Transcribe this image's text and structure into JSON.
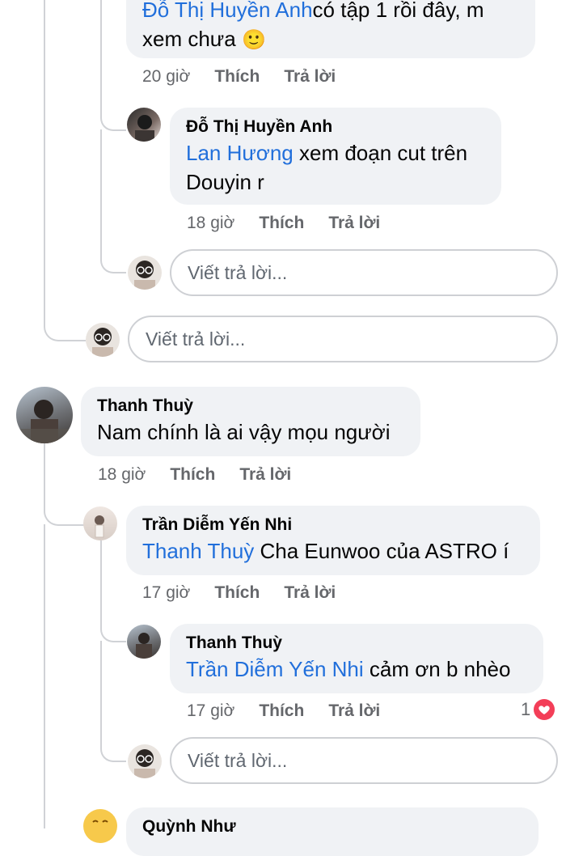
{
  "top_comment": {
    "name_partial": "Đỗ Thị Huyền Anh",
    "text_partial": "có tập 1 rồi đây, m",
    "text_line2": "xem chưa",
    "emoji": "🙂",
    "time": "20 giờ"
  },
  "comments": [
    {
      "name": "Đỗ Thị Huyền Anh",
      "mention": "Lan Hương",
      "text": " xem đoạn cut trên",
      "text_line2": "Douyin r",
      "time": "18 giờ"
    },
    {
      "name": "Thanh Thuỳ",
      "mention": "",
      "text": "Nam chính là ai vậy mọu người",
      "time": "18 giờ"
    },
    {
      "name": "Trần Diễm Yến Nhi",
      "mention": "Thanh Thuỳ",
      "text": " Cha Eunwoo của ASTRO í",
      "time": "17 giờ"
    },
    {
      "name": "Thanh Thuỳ",
      "mention": "Trần Diễm Yến Nhi",
      "text": " cảm ơn b nhèo",
      "time": "17 giờ",
      "reaction_count": "1"
    }
  ],
  "labels": {
    "like": "Thích",
    "reply": "Trả lời",
    "reply_placeholder": "Viết trả lời..."
  },
  "icons": {
    "smiley": "slightly-smiling-face",
    "heart": "heart-reaction",
    "laugh": "laughing-face"
  },
  "bottom_partial": {
    "name": "Quỳnh Như"
  }
}
